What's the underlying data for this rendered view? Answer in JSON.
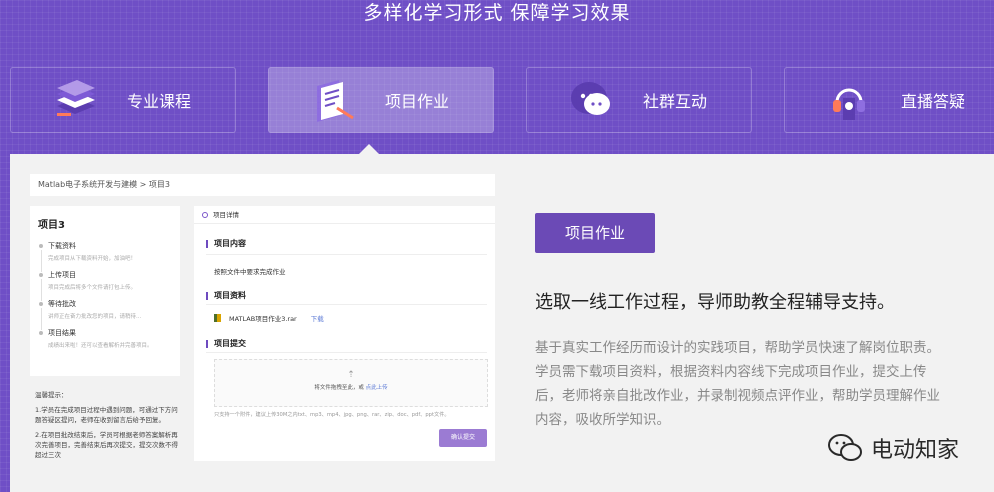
{
  "header": {
    "title": "多样化学习形式 保障学习效果"
  },
  "tabs": [
    {
      "label": "专业课程",
      "icon": "book-stack-icon",
      "active": false
    },
    {
      "label": "项目作业",
      "icon": "document-pen-icon",
      "active": true
    },
    {
      "label": "社群互动",
      "icon": "chat-bubble-icon",
      "active": false
    },
    {
      "label": "直播答疑",
      "icon": "headset-icon",
      "active": false
    }
  ],
  "preview": {
    "breadcrumb": "Matlab电子系统开发与建模 > 项目3",
    "left": {
      "title": "项目3",
      "steps": [
        {
          "label": "下载资料",
          "desc": "完成项目从下载资料开始，加油吧！"
        },
        {
          "label": "上传项目",
          "desc": "项目完成后将多个文件请打包上传。"
        },
        {
          "label": "等待批改",
          "desc": "讲师正在奋力批改您的项目，请稍待..."
        },
        {
          "label": "项目结果",
          "desc": "成绩出来啦！还可以查看解析并完善项目。"
        }
      ]
    },
    "tips": {
      "title": "温馨提示：",
      "items": [
        "1.学员在完成项目过程中遇到问题，可通过下方问题答疑区提问，老师在收到留言后给予回复。",
        "2.在项目批改结束后，学员可根据老师答案解析再次完善项目，完善结束后再次提交，提交次数不得超过三次"
      ]
    },
    "right": {
      "header": "项目详情",
      "section1": "项目内容",
      "content_text": "按照文件中要求完成作业",
      "section2": "项目资料",
      "file_name": "MATLAB项目作业3.rar",
      "download": "下载",
      "section3": "项目提交",
      "upload_text": "将文件拖拽至此，或",
      "upload_link": "点此上传",
      "note": "只支持一个附件，建议上传30M之内txt、mp3、mp4、jpg、png、rar、zip、doc、pdf、ppt文件。",
      "confirm": "确认提交"
    }
  },
  "info": {
    "badge": "项目作业",
    "slogan": "选取一线工作过程，导师助教全程辅导支持。",
    "description": "基于真实工作经历而设计的实践项目，帮助学员快速了解岗位职责。学员需下载项目资料，根据资料内容线下完成项目作业，提交上传后，老师将亲自批改作业，并录制视频点评作业，帮助学员理解作业内容，吸收所学知识。"
  },
  "watermark": {
    "text": "电动知家",
    "icon": "wechat-icon"
  },
  "colors": {
    "brand": "#6f4fc6",
    "badge": "#6b4ab6",
    "link": "#5d7bd6"
  }
}
